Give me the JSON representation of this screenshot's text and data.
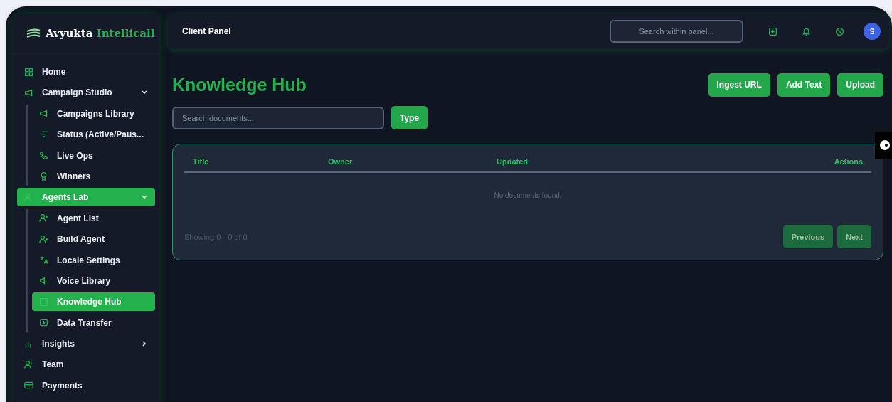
{
  "brand": {
    "name": "Avyukta",
    "accent": "Intellicall"
  },
  "sidebar": {
    "items": [
      {
        "label": "Home",
        "selected": false
      },
      {
        "label": "Campaign Studio",
        "selected": false,
        "expanded": true,
        "children": [
          {
            "label": "Campaigns Library",
            "selected": false
          },
          {
            "label": "Status (Active/Paus...",
            "selected": false
          },
          {
            "label": "Live Ops",
            "selected": false
          },
          {
            "label": "Winners",
            "selected": false
          }
        ]
      },
      {
        "label": "Agents Lab",
        "selected": true,
        "expanded": true,
        "children": [
          {
            "label": "Agent List",
            "selected": false
          },
          {
            "label": "Build Agent",
            "selected": false
          },
          {
            "label": "Locale Settings",
            "selected": false
          },
          {
            "label": "Voice Library",
            "selected": false
          },
          {
            "label": "Knowledge Hub",
            "selected": true
          },
          {
            "label": "Data Transfer",
            "selected": false
          }
        ]
      },
      {
        "label": "Insights",
        "selected": false,
        "expanded": false
      },
      {
        "label": "Team",
        "selected": false
      },
      {
        "label": "Payments",
        "selected": false
      }
    ]
  },
  "topbar": {
    "title": "Client Panel",
    "search": {
      "placeholder": "Search within panel..."
    },
    "avatar": "S"
  },
  "page": {
    "title": "Knowledge Hub",
    "actions": [
      "Ingest URL",
      "Add Text",
      "Upload"
    ],
    "search": {
      "placeholder": "Search documents..."
    },
    "filter_button": "Type"
  },
  "table": {
    "columns": [
      "Title",
      "Owner",
      "Updated",
      "Actions"
    ],
    "empty_message": "No documents found.",
    "summary": "Showing 0 - 0 of 0",
    "pagination": [
      {
        "label": "Previous",
        "disabled": true
      },
      {
        "label": "Next",
        "disabled": true
      }
    ]
  }
}
